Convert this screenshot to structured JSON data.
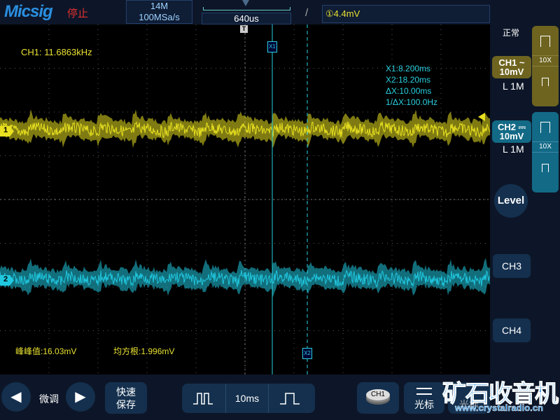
{
  "header": {
    "logo": "Micsig",
    "run_status": "停止",
    "memory_depth": "14M",
    "sample_rate": "100MSa/s",
    "timebase_offset": "640us",
    "trigger_slope": "/",
    "trigger_level": "①4.4mV"
  },
  "plot": {
    "frequency": "CH1: 11.6863kHz",
    "cursors": {
      "x1": "X1:8.200ms",
      "x2": "X2:18.20ms",
      "dx": "ΔX:10.00ms",
      "inv_dx": "1/ΔX:100.0Hz",
      "x1_tag": "X1",
      "x2_tag": "X2"
    },
    "trigger_marker": "T",
    "ch1_marker": "1",
    "ch2_marker": "2",
    "measure_pkpk": "峰峰值:16.03mV",
    "measure_rms": "均方根:1.996mV"
  },
  "right": {
    "acq_mode": "正常",
    "ch1": {
      "label": "CH1 ~",
      "scale": "10mV",
      "coupling": "L 1M",
      "probe": "10X",
      "color": "#6e6420"
    },
    "ch2": {
      "label": "CH2 ⎓",
      "scale": "10mV",
      "coupling": "L 1M",
      "probe": "10X",
      "color": "#136a86"
    },
    "level": "Level",
    "ch3": "CH3",
    "ch4": "CH4"
  },
  "bottom": {
    "fine": "微调",
    "quick_save_1": "快速",
    "quick_save_2": "保存",
    "timebase": "10ms",
    "ch_select": "CH1",
    "cursor": "光标",
    "cursor2": "光标",
    "watermark": "矿石收音机",
    "watermark_url": "www.crystalradio.cn"
  },
  "colors": {
    "ch1": "#e8e020",
    "ch2": "#20c8e0"
  }
}
